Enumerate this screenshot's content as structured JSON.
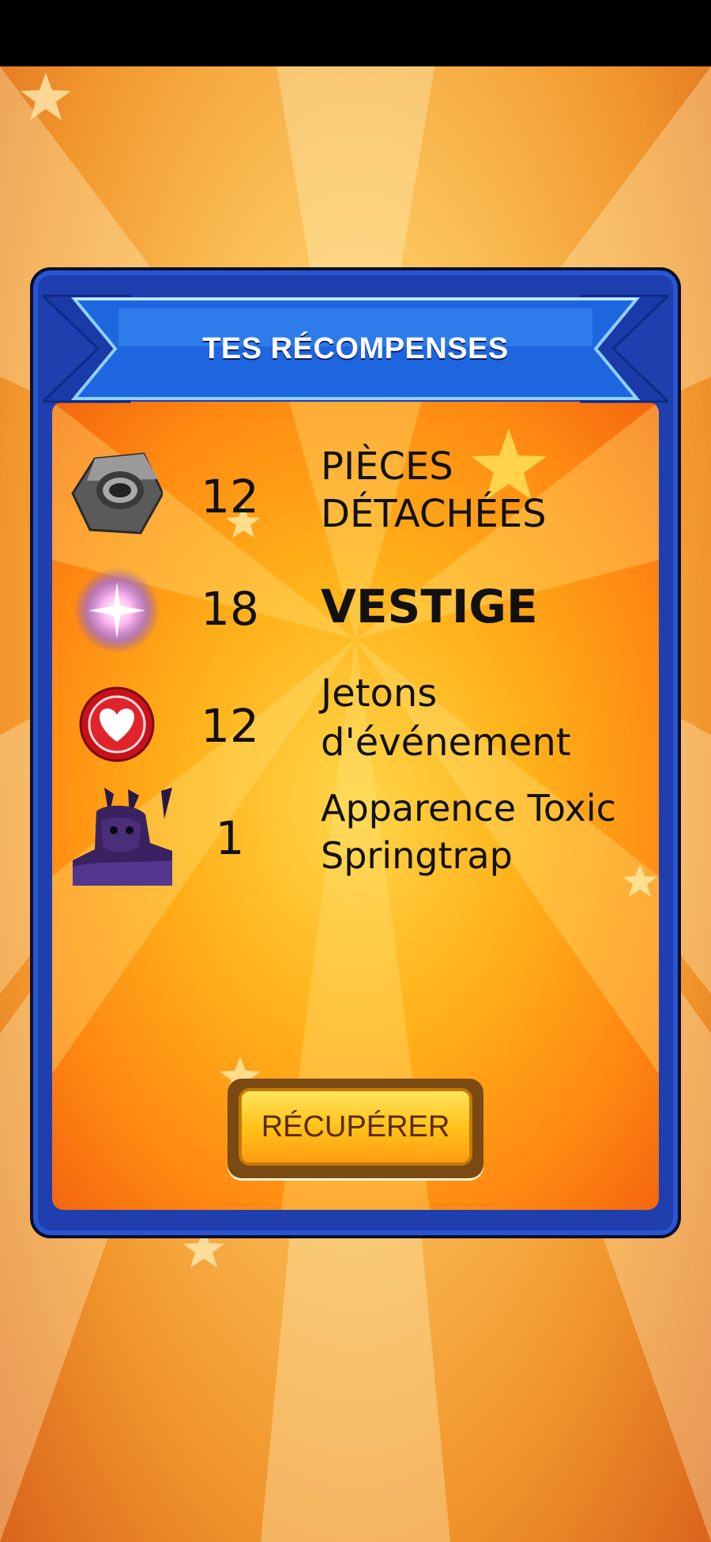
{
  "dialog": {
    "title": "TES RÉCOMPENSES",
    "claim_label": "RÉCUPÉRER"
  },
  "rewards": [
    {
      "icon": "hex-nut-icon",
      "count": "12",
      "label_line1": "PIÈCES",
      "label_line2": "DÉTACHÉES"
    },
    {
      "icon": "glowing-orb-icon",
      "count": "18",
      "label_line1": "VESTIGE",
      "label_line2": ""
    },
    {
      "icon": "heart-token-icon",
      "count": "12",
      "label_line1": "Jetons",
      "label_line2": "d'événement"
    },
    {
      "icon": "springtrap-skin-icon",
      "count": "1",
      "label_line1": "Apparence Toxic",
      "label_line2": "Springtrap"
    }
  ],
  "colors": {
    "panel_blue": "#1f3fae",
    "ribbon_blue": "#1e66e0",
    "inner_orange": "#ffb21a",
    "button_yellow": "#ffc21a"
  }
}
